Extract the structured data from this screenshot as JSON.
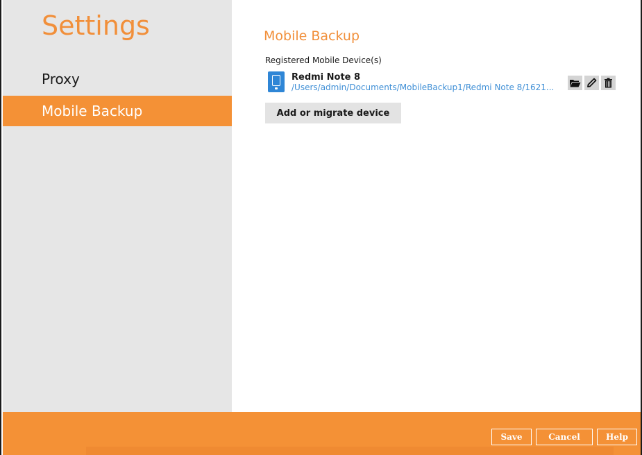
{
  "sidebar": {
    "title": "Settings",
    "items": [
      {
        "label": "Proxy",
        "active": false
      },
      {
        "label": "Mobile Backup",
        "active": true
      }
    ]
  },
  "main": {
    "title": "Mobile Backup",
    "section_label": "Registered Mobile Device(s)",
    "devices": [
      {
        "name": "Redmi Note 8",
        "path": "/Users/admin/Documents/MobileBackup1/Redmi Note 8/1621...",
        "icon": "mobile-phone-icon",
        "actions": [
          "folder-open-icon",
          "pencil-icon",
          "trash-icon"
        ]
      }
    ],
    "add_button_label": "Add or migrate device"
  },
  "footer": {
    "save_label": "Save",
    "cancel_label": "Cancel",
    "help_label": "Help"
  },
  "colors": {
    "accent": "#f49136",
    "title_orange": "#f18f3a",
    "link_blue": "#3f8fd6",
    "sidebar_bg": "#e6e6e6",
    "device_icon_blue": "#2f86d6"
  }
}
